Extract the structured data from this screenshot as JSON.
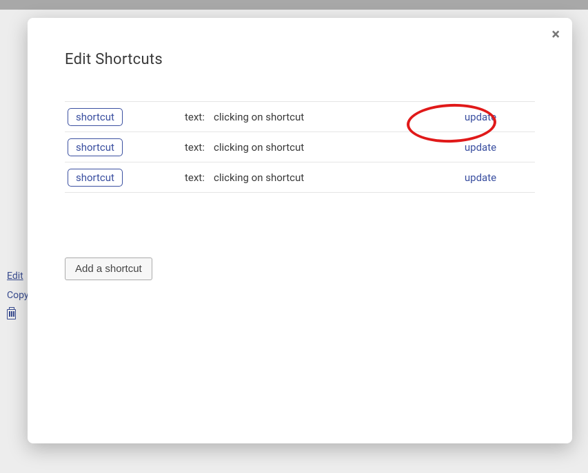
{
  "modal": {
    "title": "Edit Shortcuts",
    "add_button": "Add a shortcut",
    "close_label": "×",
    "rows": [
      {
        "shortcut": "shortcut",
        "text_label": "text:",
        "text_value": "clicking on shortcut",
        "update": "update"
      },
      {
        "shortcut": "shortcut",
        "text_label": "text:",
        "text_value": "clicking on shortcut",
        "update": "update"
      },
      {
        "shortcut": "shortcut",
        "text_label": "text:",
        "text_value": "clicking on shortcut",
        "update": "update"
      }
    ]
  },
  "side": {
    "edit": "Edit",
    "copy": "Copy"
  }
}
